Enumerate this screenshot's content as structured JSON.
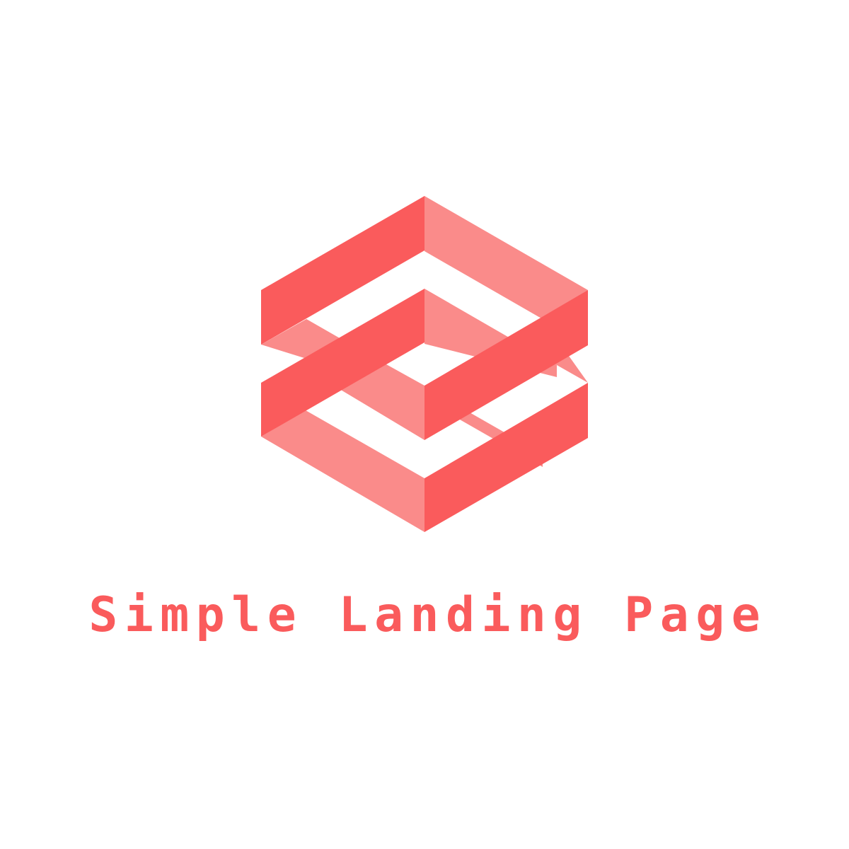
{
  "brand": {
    "name": "Simple Landing Page",
    "icon": "isometric-hexagon-ribbon-logo-icon",
    "colors": {
      "primary": "#fa5b5c",
      "secondary": "#fa8b8a",
      "background": "#ffffff"
    }
  }
}
